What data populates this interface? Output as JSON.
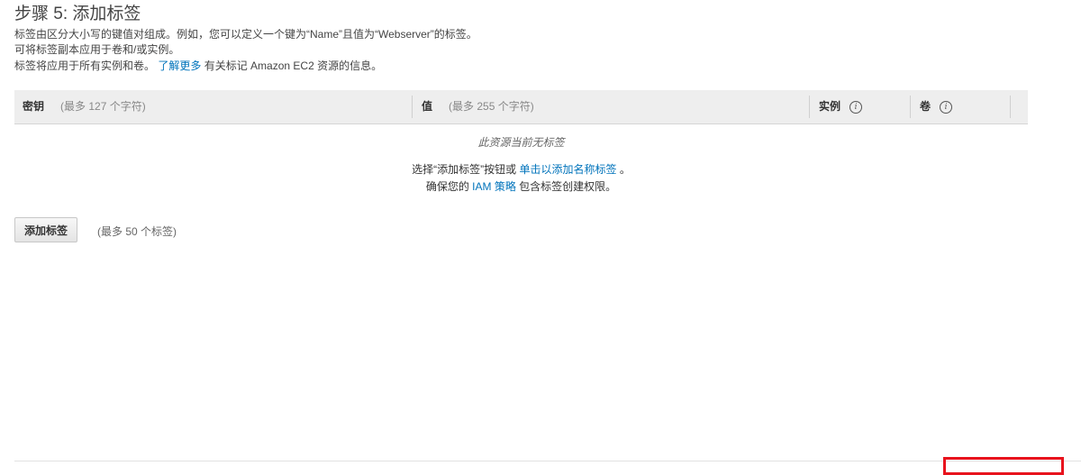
{
  "page": {
    "title": "步骤 5: 添加标签",
    "desc_line1": "标签由区分大小写的键值对组成。例如，您可以定义一个键为“Name”且值为“Webserver”的标签。",
    "desc_line2": "可将标签副本应用于卷和/或实例。",
    "desc_line3_prefix": "标签将应用于所有实例和卷。",
    "desc_line3_link": "了解更多",
    "desc_line3_suffix": " 有关标记 Amazon EC2 资源的信息。"
  },
  "table": {
    "columns": [
      {
        "label": "密钥",
        "hint": "(最多 127 个字符)"
      },
      {
        "label": "值",
        "hint": "(最多 255 个字符)"
      },
      {
        "label": "实例",
        "icon": "info-icon"
      },
      {
        "label": "卷",
        "icon": "info-icon"
      }
    ],
    "empty": {
      "message": "此资源当前无标签",
      "line1_prefix": "选择“添加标签”按钮或 ",
      "line1_link": "单击以添加名称标签",
      "line1_suffix": " 。",
      "line2_prefix": "确保您的 ",
      "line2_link": "IAM 策略",
      "line2_suffix": " 包含标签创建权限。"
    }
  },
  "add": {
    "button_label": "添加标签",
    "limit": "(最多 50 个标签)"
  },
  "colors": {
    "link": "#0073bb",
    "header_bg": "#eeeeee",
    "highlight": "#e8131d"
  }
}
